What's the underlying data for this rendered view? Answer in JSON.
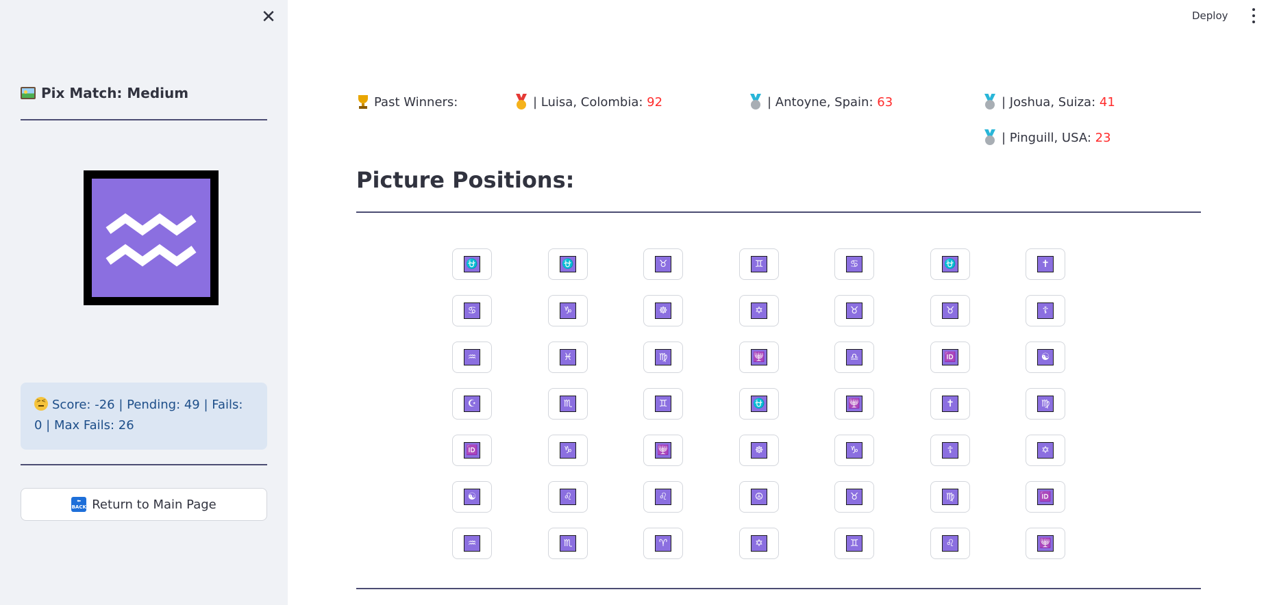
{
  "header": {
    "deploy_label": "Deploy",
    "menu_icon": "kebab-menu-icon"
  },
  "sidebar": {
    "close_icon": "close-icon",
    "title": "Pix Match: Medium",
    "title_icon": "framed-picture-icon",
    "target_symbol": "aquarius-icon",
    "status": "Score: -26 | Pending: 49 | Fails: 0 | Max Fails: 26",
    "status_icon": "confounded-face-icon",
    "return_label": "Return to Main Page",
    "return_icon": "back-arrow-icon"
  },
  "winners": {
    "label": "Past Winners:",
    "label_icon": "trophy-icon",
    "entries": [
      {
        "name": "| Luisa, Colombia:",
        "score": "92",
        "medal": "gold-medal-icon"
      },
      {
        "name": "| Antoyne, Spain:",
        "score": "63",
        "medal": "silver-medal-icon"
      },
      {
        "name": "| Joshua, Suiza:",
        "score": "41",
        "medal": "silver-medal-icon"
      },
      {
        "name": "| Pinguill, USA:",
        "score": "23",
        "medal": "silver-medal-icon"
      }
    ]
  },
  "main": {
    "title": "Picture Positions:",
    "grid": [
      [
        "⛎",
        "⛎",
        "♉",
        "♊",
        "♋",
        "⛎",
        "✝"
      ],
      [
        "♋",
        "♑",
        "☸",
        "✡",
        "♉",
        "♉",
        "☦"
      ],
      [
        "♒",
        "♓",
        "♍",
        "🕎",
        "♎",
        "🆔",
        "☯"
      ],
      [
        "☪",
        "♏",
        "♊",
        "⛎",
        "🕎",
        "✝",
        "♍"
      ],
      [
        "🆔",
        "♑",
        "🕎",
        "☸",
        "♑",
        "☦",
        "✡"
      ],
      [
        "☯",
        "♌",
        "♌",
        "☮",
        "♉",
        "♍",
        "🆔"
      ],
      [
        "♒",
        "♏",
        "♈",
        "✡",
        "♊",
        "♌",
        "🕎"
      ]
    ]
  },
  "colors": {
    "tile": "#8b6fe0",
    "accent_rule": "#4b4c72",
    "score": "#ff2b2b",
    "info_bg": "#dce6f3"
  }
}
